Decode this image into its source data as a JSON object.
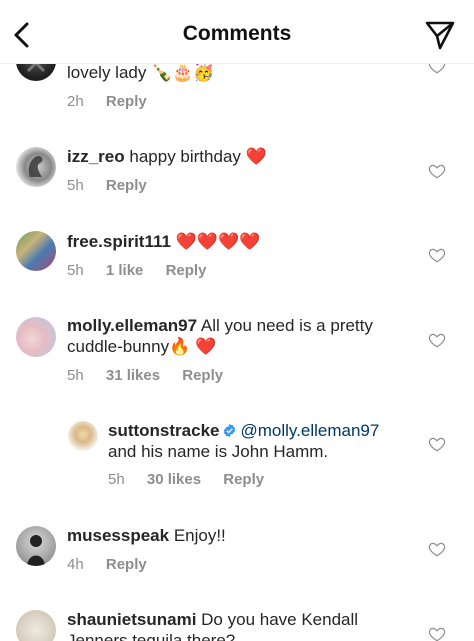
{
  "header": {
    "title": "Comments"
  },
  "comments": [
    {
      "username": "",
      "text": "lovely lady 🍾🎂🥳",
      "time": "2h",
      "likes": "",
      "reply": "Reply"
    },
    {
      "username": "izz_reo",
      "text": "happy birthday ❤️",
      "time": "5h",
      "likes": "",
      "reply": "Reply"
    },
    {
      "username": "free.spirit111",
      "text": "❤️❤️❤️❤️",
      "time": "5h",
      "likes": "1 like",
      "reply": "Reply"
    },
    {
      "username": "molly.elleman97",
      "text": "All you need is a pretty cuddle-bunny🔥 ❤️",
      "time": "5h",
      "likes": "31 likes",
      "reply": "Reply"
    },
    {
      "username": "suttonstracke",
      "mention": "@molly.elleman97",
      "text": "and his name is John Hamm.",
      "time": "5h",
      "likes": "30 likes",
      "reply": "Reply",
      "verified": true
    },
    {
      "username": "musesspeak",
      "text": "Enjoy!!",
      "time": "4h",
      "likes": "",
      "reply": "Reply"
    },
    {
      "username": "shaunietsunami",
      "text": "Do you have Kendall Jenners tequila there?",
      "time": "",
      "likes": "",
      "reply": ""
    }
  ]
}
